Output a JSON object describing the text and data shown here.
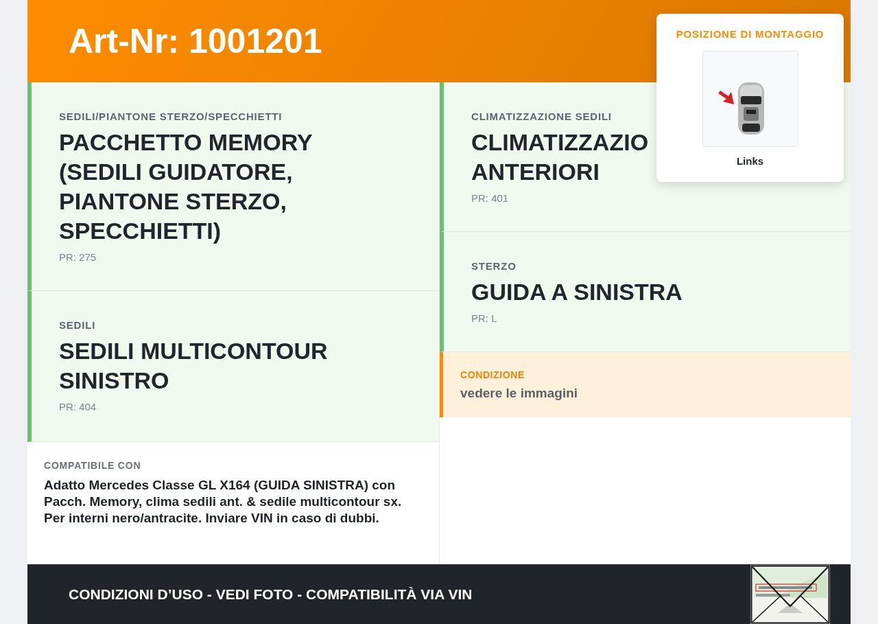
{
  "header": {
    "title": "Art-Nr: 1001201"
  },
  "mounting": {
    "label": "POSIZIONE DI MONTAGGIO",
    "position": "Links"
  },
  "columns": [
    {
      "cards": [
        {
          "kind": "spec",
          "category": "SEDILI/PIANTONE STERZO/SPECCHIETTI",
          "title_lines": [
            "PACCHETTO MEMORY",
            "(SEDILI GUIDATORE,",
            "PIANTONE STERZO,",
            "SPECCHIETTI)"
          ],
          "code": "PR: 275"
        },
        {
          "kind": "spec",
          "category": "SEDILI",
          "title_lines": [
            "SEDILI MULTICONTOUR",
            "SINISTRO"
          ],
          "code": "PR: 404"
        },
        {
          "kind": "note",
          "label": "COMPATIBILE CON",
          "text": "Adatto Mercedes Classe GL X164 (GUIDA SINISTRA) con Pacch. Memory, clima sedili ant. & sedile multicontour sx. Per interni nero/antracite. Inviare VIN in caso di dubbi."
        }
      ]
    },
    {
      "cards": [
        {
          "kind": "spec",
          "category": "CLIMATIZZAZIONE SEDILI",
          "title_lines": [
            "CLIMATIZZAZIO",
            "ANTERIORI"
          ],
          "code": "PR: 401"
        },
        {
          "kind": "spec",
          "category": "STERZO",
          "title_lines": [
            "GUIDA A SINISTRA"
          ],
          "code": "PR: L"
        },
        {
          "kind": "condition",
          "label": "CONDIZIONE",
          "text": "vedere le immagini"
        }
      ]
    }
  ],
  "footer": {
    "text": "CONDIZIONI D’USO - VEDI FOTO - COMPATIBILITÀ VIA VIN"
  }
}
